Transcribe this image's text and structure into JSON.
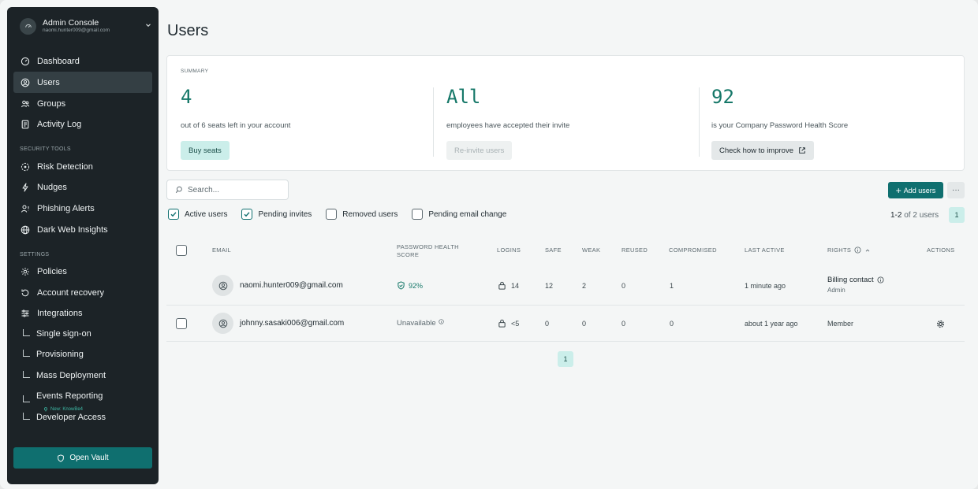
{
  "account": {
    "title": "Admin Console",
    "email": "naomi.hunter009@gmail.com"
  },
  "sidebar": {
    "main_items": [
      {
        "label": "Dashboard",
        "icon": "gauge-icon"
      },
      {
        "label": "Users",
        "icon": "user-circle-icon",
        "active": true
      },
      {
        "label": "Groups",
        "icon": "users-icon"
      },
      {
        "label": "Activity Log",
        "icon": "log-icon"
      }
    ],
    "security_label": "SECURITY TOOLS",
    "security_items": [
      {
        "label": "Risk Detection",
        "icon": "radar-icon"
      },
      {
        "label": "Nudges",
        "icon": "bolt-icon"
      },
      {
        "label": "Phishing Alerts",
        "icon": "user-alert-icon"
      },
      {
        "label": "Dark Web Insights",
        "icon": "globe-icon"
      }
    ],
    "settings_label": "SETTINGS",
    "settings_items": [
      {
        "label": "Policies",
        "icon": "gear-icon"
      },
      {
        "label": "Account recovery",
        "icon": "recovery-icon"
      },
      {
        "label": "Integrations",
        "icon": "sliders-icon"
      }
    ],
    "integration_subitems": [
      {
        "label": "Single sign-on"
      },
      {
        "label": "Provisioning"
      },
      {
        "label": "Mass Deployment"
      },
      {
        "label": "Events Reporting"
      },
      {
        "label": "Developer Access"
      }
    ],
    "new_tag": "New: KnowBe4",
    "open_vault": "Open Vault"
  },
  "page": {
    "title": "Users"
  },
  "summary": {
    "label": "SUMMARY",
    "seats": {
      "value": "4",
      "desc": "out of 6 seats left in your account",
      "button": "Buy seats"
    },
    "invites": {
      "value": "All",
      "desc": "employees have accepted their invite",
      "button": "Re-invite users"
    },
    "health": {
      "value": "92",
      "desc": "is your Company Password Health Score",
      "button": "Check how to improve"
    }
  },
  "toolbar": {
    "search_placeholder": "Search...",
    "add_users": "Add users",
    "more": "···"
  },
  "filters": [
    {
      "label": "Active users",
      "checked": true
    },
    {
      "label": "Pending invites",
      "checked": true
    },
    {
      "label": "Removed users",
      "checked": false
    },
    {
      "label": "Pending email change",
      "checked": false
    }
  ],
  "pagination": {
    "range": "1-2",
    "of_text": "of 2 users",
    "page": "1"
  },
  "table": {
    "headers": {
      "email": "EMAIL",
      "health_1": "PASSWORD HEALTH",
      "health_2": "SCORE",
      "logins": "LOGINS",
      "safe": "SAFE",
      "weak": "WEAK",
      "reused": "REUSED",
      "compromised": "COMPROMISED",
      "last_active": "LAST ACTIVE",
      "rights": "RIGHTS",
      "actions": "ACTIONS"
    },
    "rows": [
      {
        "email": "naomi.hunter009@gmail.com",
        "health": "92%",
        "logins": "14",
        "safe": "12",
        "weak": "2",
        "reused": "0",
        "compromised": "1",
        "last_active": "1 minute ago",
        "rights": "Billing contact",
        "rights_sub": "Admin"
      },
      {
        "email": "johnny.sasaki006@gmail.com",
        "health": "Unavailable",
        "logins": "<5",
        "safe": "0",
        "weak": "0",
        "reused": "0",
        "compromised": "0",
        "last_active": "about 1 year ago",
        "rights": "Member"
      }
    ]
  },
  "colors": {
    "accent": "#0f6f6f",
    "score": "#167869",
    "sidebar": "#1c2327"
  }
}
